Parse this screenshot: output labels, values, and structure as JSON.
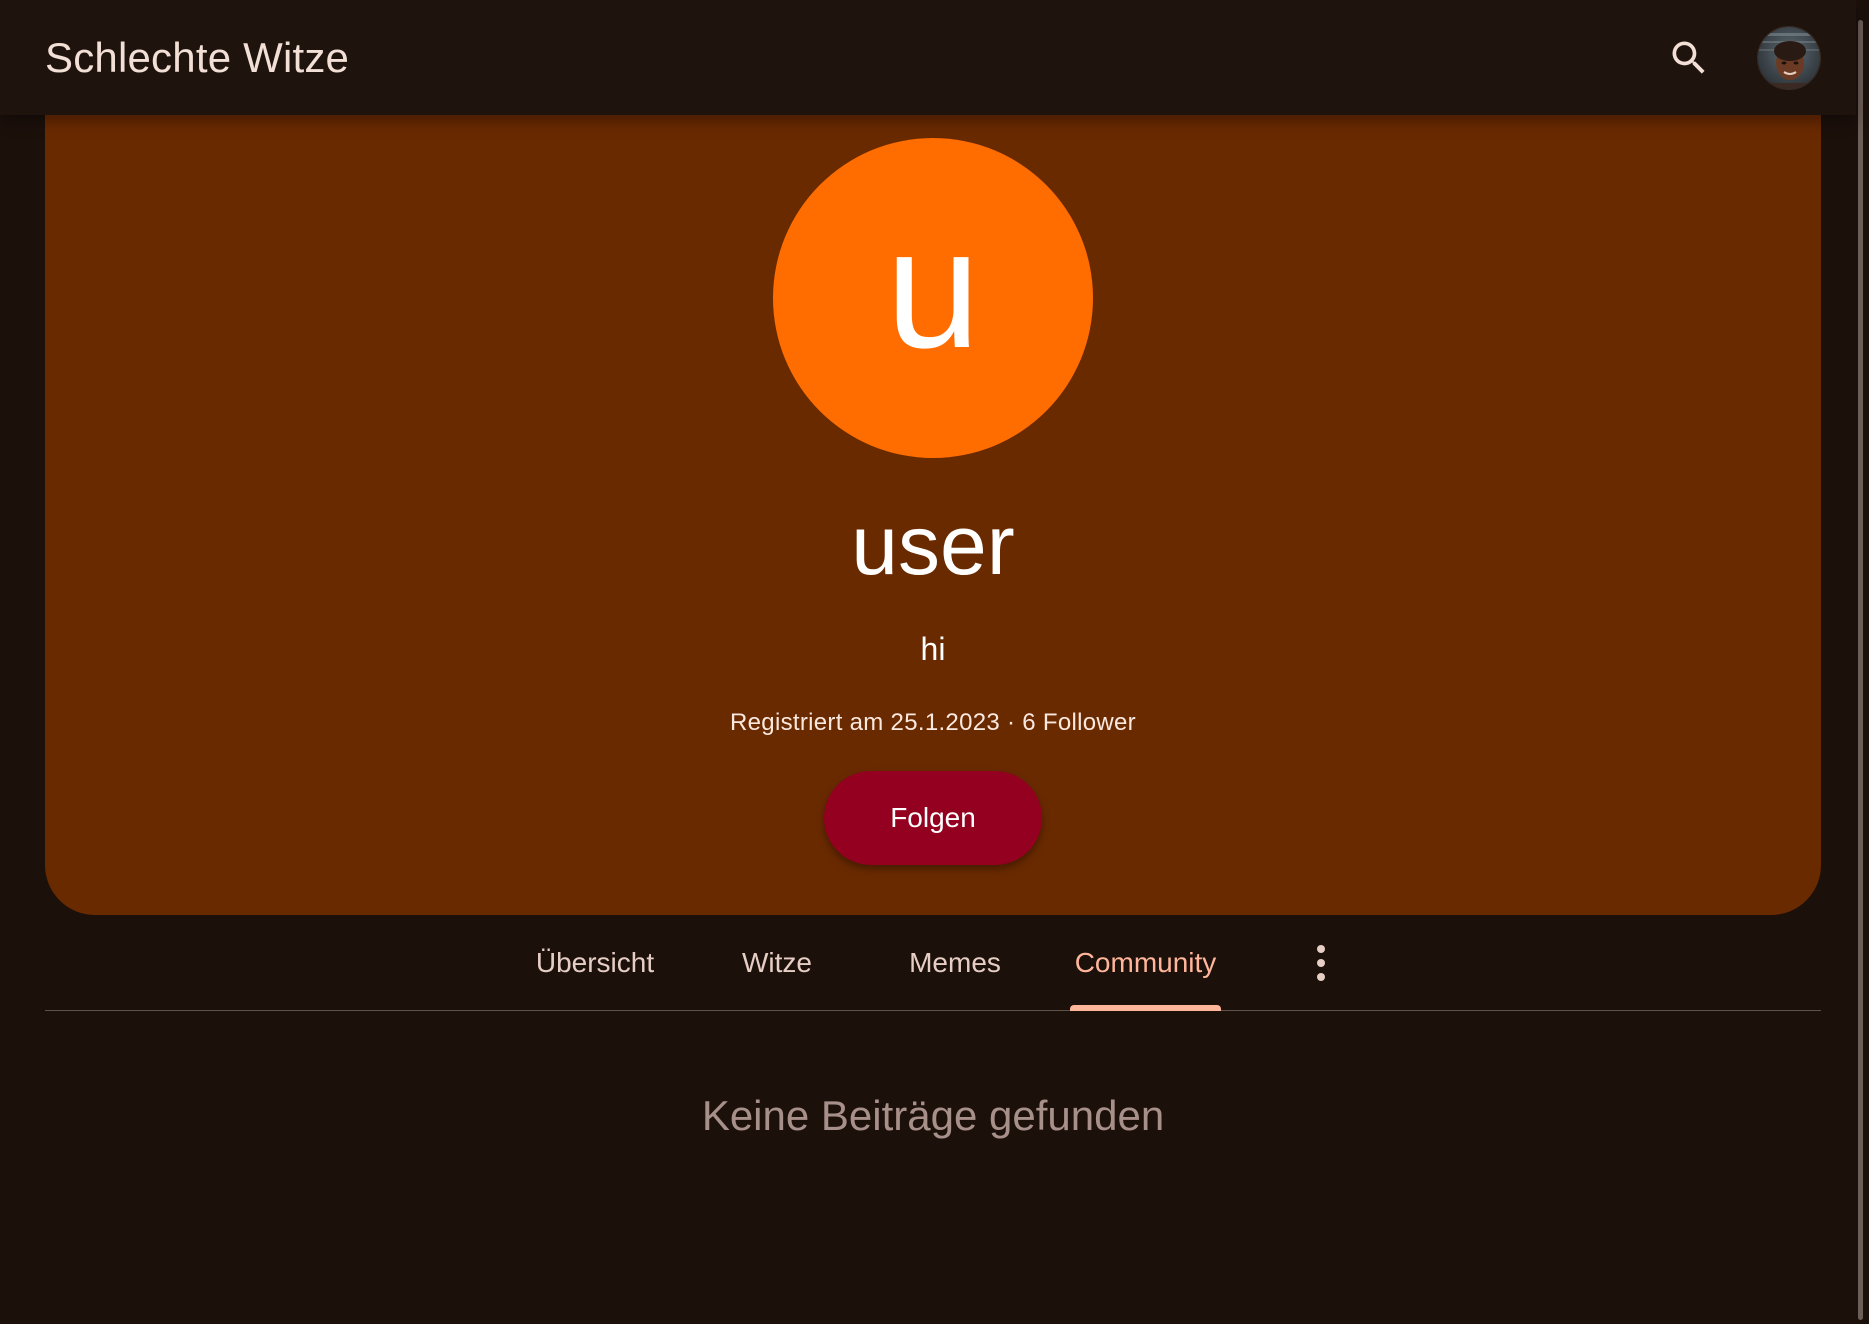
{
  "app": {
    "title": "Schlechte Witze"
  },
  "header": {
    "search_icon": "search-icon",
    "account_avatar": "account-avatar-photo"
  },
  "profile": {
    "avatar_letter": "u",
    "name": "user",
    "bio": "hi",
    "meta": "Registriert am 25.1.2023 · 6 Follower",
    "follow_label": "Folgen"
  },
  "tabs": {
    "items": [
      {
        "label": "Übersicht"
      },
      {
        "label": "Witze"
      },
      {
        "label": "Memes"
      },
      {
        "label": "Community"
      }
    ],
    "active_index": 3,
    "more_icon": "more-vertical-icon"
  },
  "content": {
    "empty_message": "Keine Beiträge gefunden"
  },
  "colors": {
    "background": "#1c100b",
    "card": "#6a2a00",
    "avatar": "#ff6d00",
    "follow_button": "#930020",
    "tab_active": "#ffb59a"
  }
}
